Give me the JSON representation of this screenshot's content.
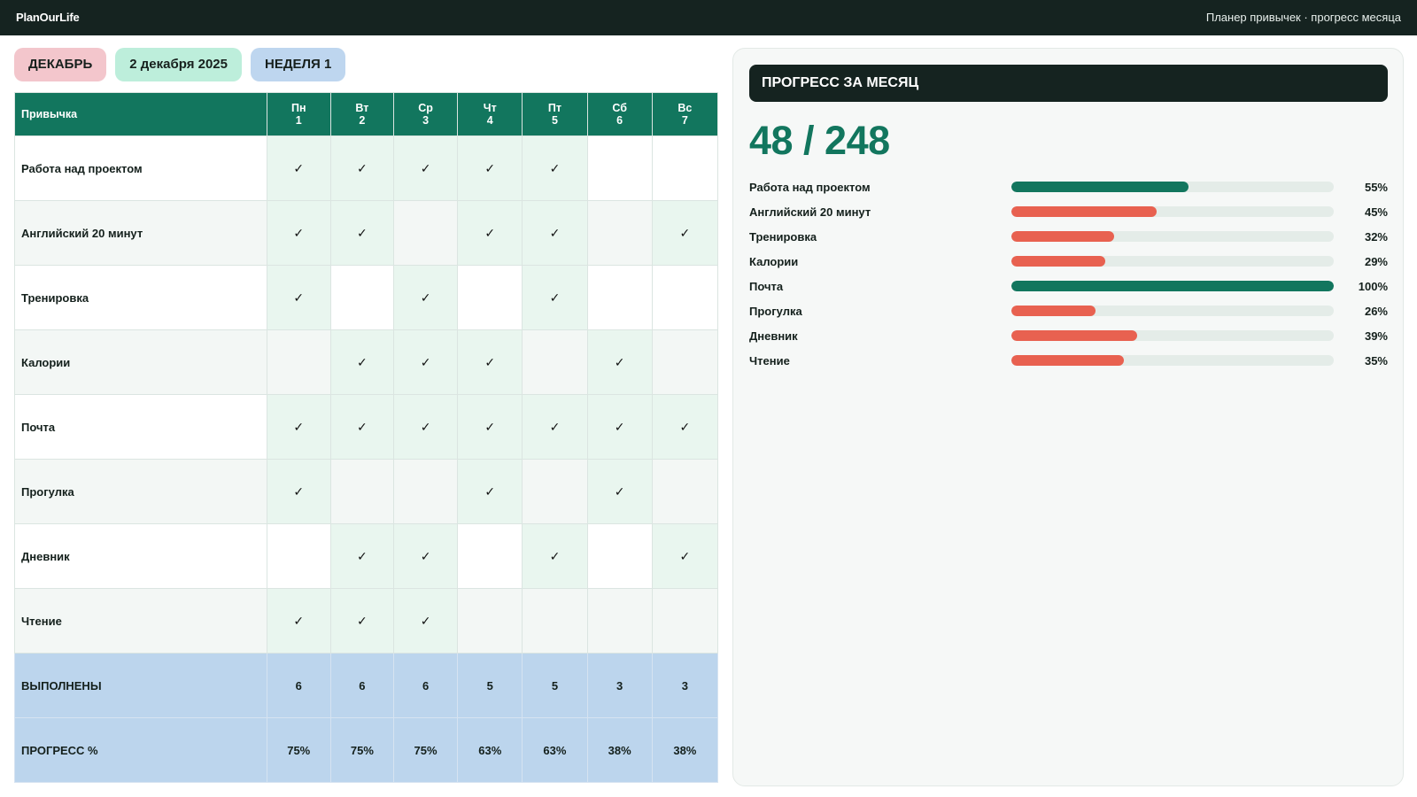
{
  "app": {
    "brand": "PlanOurLife",
    "subtitle": "Планер привычек · прогресс месяца"
  },
  "chips": {
    "month": "ДЕКАБРЬ",
    "date": "2 декабря 2025",
    "week": "НЕДЕЛЯ 1"
  },
  "tracker": {
    "habit_header": "Привычка",
    "days": [
      {
        "name": "Пн",
        "num": "1"
      },
      {
        "name": "Вт",
        "num": "2"
      },
      {
        "name": "Ср",
        "num": "3"
      },
      {
        "name": "Чт",
        "num": "4"
      },
      {
        "name": "Пт",
        "num": "5"
      },
      {
        "name": "Сб",
        "num": "6"
      },
      {
        "name": "Вс",
        "num": "7"
      }
    ],
    "check_mark": "✓",
    "rows": [
      {
        "habit": "Работа над проектом",
        "checks": [
          true,
          true,
          true,
          true,
          true,
          false,
          false
        ]
      },
      {
        "habit": "Английский 20 минут",
        "checks": [
          true,
          true,
          false,
          true,
          true,
          false,
          true
        ]
      },
      {
        "habit": "Тренировка",
        "checks": [
          true,
          false,
          true,
          false,
          true,
          false,
          false
        ]
      },
      {
        "habit": "Калории",
        "checks": [
          false,
          true,
          true,
          true,
          false,
          true,
          false
        ]
      },
      {
        "habit": "Почта",
        "checks": [
          true,
          true,
          true,
          true,
          true,
          true,
          true
        ]
      },
      {
        "habit": "Прогулка",
        "checks": [
          true,
          false,
          false,
          true,
          false,
          true,
          false
        ]
      },
      {
        "habit": "Дневник",
        "checks": [
          false,
          true,
          true,
          false,
          true,
          false,
          true
        ]
      },
      {
        "habit": "Чтение",
        "checks": [
          true,
          true,
          true,
          false,
          false,
          false,
          false
        ]
      }
    ],
    "done_label": "ВЫПОЛНЕНЫ",
    "done": [
      "6",
      "6",
      "6",
      "5",
      "5",
      "3",
      "3"
    ],
    "progress_label": "ПРОГРЕСС %",
    "progress": [
      "75%",
      "75%",
      "75%",
      "63%",
      "63%",
      "38%",
      "38%"
    ]
  },
  "summary": {
    "title": "ПРОГРЕСС ЗА МЕСЯЦ",
    "total": "48 / 248",
    "colors": {
      "good": "#12765e",
      "low": "#e86150",
      "track": "#e4ece8"
    },
    "items": [
      {
        "habit": "Работа над проектом",
        "percent": 55,
        "label": "55%",
        "status": "good"
      },
      {
        "habit": "Английский 20 минут",
        "percent": 45,
        "label": "45%",
        "status": "low"
      },
      {
        "habit": "Тренировка",
        "percent": 32,
        "label": "32%",
        "status": "low"
      },
      {
        "habit": "Калории",
        "percent": 29,
        "label": "29%",
        "status": "low"
      },
      {
        "habit": "Почта",
        "percent": 100,
        "label": "100%",
        "status": "good"
      },
      {
        "habit": "Прогулка",
        "percent": 26,
        "label": "26%",
        "status": "low"
      },
      {
        "habit": "Дневник",
        "percent": 39,
        "label": "39%",
        "status": "low"
      },
      {
        "habit": "Чтение",
        "percent": 35,
        "label": "35%",
        "status": "low"
      }
    ]
  }
}
